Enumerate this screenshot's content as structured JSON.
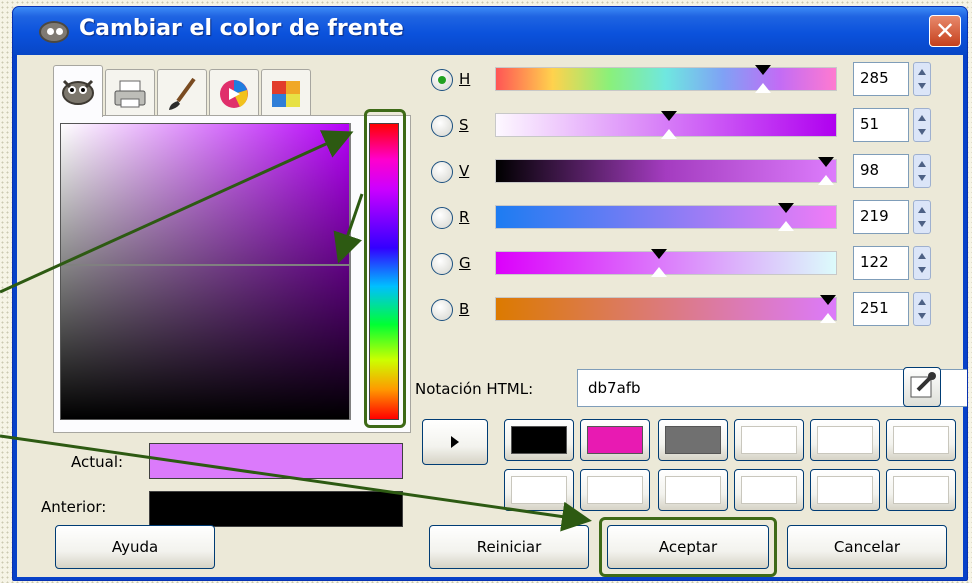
{
  "window": {
    "title": "Cambiar el color de frente",
    "close_glyph": "✕"
  },
  "tabs": [
    {
      "icon": "gimp-selector-icon",
      "active": true
    },
    {
      "icon": "cmyk-printer-icon",
      "active": false
    },
    {
      "icon": "watercolor-brush-icon",
      "active": false
    },
    {
      "icon": "color-wheel-icon",
      "active": false
    },
    {
      "icon": "palette-swatches-icon",
      "active": false
    }
  ],
  "channels": [
    {
      "key": "H",
      "value": "285",
      "selected": true
    },
    {
      "key": "S",
      "value": "51",
      "selected": false
    },
    {
      "key": "V",
      "value": "98",
      "selected": false
    },
    {
      "key": "R",
      "value": "219",
      "selected": false
    },
    {
      "key": "G",
      "value": "122",
      "selected": false
    },
    {
      "key": "B",
      "value": "251",
      "selected": false
    }
  ],
  "html_notation": {
    "label": "Notación HTML:",
    "value": "db7afb"
  },
  "current": {
    "label": "Actual:",
    "color": "#db7afb"
  },
  "previous": {
    "label": "Anterior:",
    "color": "#000000"
  },
  "history": [
    "#000000",
    "#e81ab2",
    "#707070",
    "#ffffff",
    "#ffffff",
    "#ffffff",
    "#ffffff",
    "#ffffff",
    "#ffffff",
    "#ffffff",
    "#ffffff",
    "#ffffff"
  ],
  "buttons": {
    "help": "Ayuda",
    "reset": "Reiniciar",
    "ok": "Aceptar",
    "cancel": "Cancelar"
  },
  "colors": {
    "titlebar": "#0b52dc",
    "highlight": "#3e6a17",
    "annotation_arrow": "#2d5a12"
  }
}
